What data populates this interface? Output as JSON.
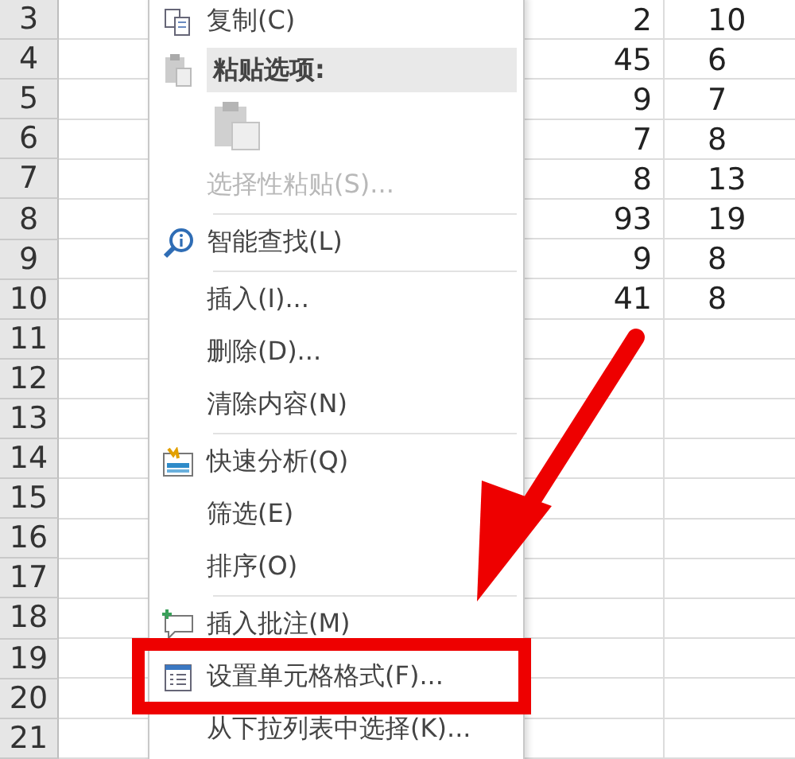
{
  "sheet": {
    "rows": [
      {
        "label": "3",
        "column_2": "2",
        "column_3": "10"
      },
      {
        "label": "4",
        "column_2": "45",
        "column_3": "6"
      },
      {
        "label": "5",
        "column_2": "9",
        "column_3": "7"
      },
      {
        "label": "6",
        "column_2": "7",
        "column_3": "8"
      },
      {
        "label": "7",
        "column_2": "8",
        "column_3": "13"
      },
      {
        "label": "8",
        "column_2": "93",
        "column_3": "19"
      },
      {
        "label": "9",
        "column_2": "9",
        "column_3": "8"
      },
      {
        "label": "10",
        "column_2": "41",
        "column_3": "8"
      },
      {
        "label": "11"
      },
      {
        "label": "12"
      },
      {
        "label": "13"
      },
      {
        "label": "14"
      },
      {
        "label": "15"
      },
      {
        "label": "16"
      },
      {
        "label": "17"
      },
      {
        "label": "18"
      },
      {
        "label": "19"
      },
      {
        "label": "20"
      },
      {
        "label": "21"
      }
    ]
  },
  "context_menu": {
    "items": [
      {
        "kind": "item",
        "label": "复制(C)",
        "disabled": false
      },
      {
        "kind": "header",
        "label": "粘贴选项:"
      },
      {
        "kind": "paste-options"
      },
      {
        "kind": "item",
        "label": "选择性粘贴(S)...",
        "disabled": true
      },
      {
        "kind": "separator"
      },
      {
        "kind": "item",
        "label": "智能查找(L)",
        "disabled": false
      },
      {
        "kind": "separator"
      },
      {
        "kind": "item",
        "label": "插入(I)...",
        "disabled": false
      },
      {
        "kind": "item",
        "label": "删除(D)...",
        "disabled": false
      },
      {
        "kind": "item",
        "label": "清除内容(N)",
        "disabled": false
      },
      {
        "kind": "separator"
      },
      {
        "kind": "item",
        "label": "快速分析(Q)",
        "disabled": false
      },
      {
        "kind": "item",
        "label": "筛选(E)",
        "disabled": false
      },
      {
        "kind": "item",
        "label": "排序(O)",
        "disabled": false
      },
      {
        "kind": "separator"
      },
      {
        "kind": "item",
        "label": "插入批注(M)",
        "disabled": false
      },
      {
        "kind": "item",
        "label": "设置单元格格式(F)...",
        "disabled": false
      },
      {
        "kind": "item",
        "label": "从下拉列表中选择(K)...",
        "disabled": false
      }
    ]
  }
}
